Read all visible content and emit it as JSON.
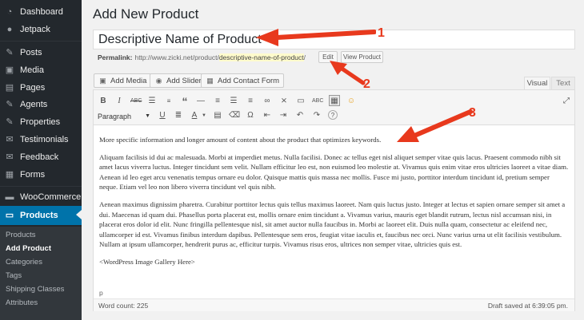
{
  "sidebar": {
    "items": [
      {
        "label": "Dashboard",
        "icon": "dashboard-icon",
        "glyph": "◔"
      },
      {
        "label": "Jetpack",
        "icon": "jetpack-icon",
        "glyph": "●"
      },
      {
        "label": "Posts",
        "icon": "pin-icon",
        "glyph": "✎"
      },
      {
        "label": "Media",
        "icon": "media-icon",
        "glyph": "▣"
      },
      {
        "label": "Pages",
        "icon": "pages-icon",
        "glyph": "▤"
      },
      {
        "label": "Agents",
        "icon": "pin-icon",
        "glyph": "✎"
      },
      {
        "label": "Properties",
        "icon": "pin-icon",
        "glyph": "✎"
      },
      {
        "label": "Testimonials",
        "icon": "comment-icon",
        "glyph": "✉"
      },
      {
        "label": "Feedback",
        "icon": "comment-icon",
        "glyph": "✉"
      },
      {
        "label": "Forms",
        "icon": "forms-icon",
        "glyph": "▦"
      },
      {
        "label": "WooCommerce",
        "icon": "woocommerce-icon",
        "glyph": "▬"
      },
      {
        "label": "Products",
        "icon": "products-icon",
        "glyph": "▭"
      }
    ],
    "submenu": [
      "Products",
      "Add Product",
      "Categories",
      "Tags",
      "Shipping Classes",
      "Attributes"
    ]
  },
  "header": {
    "title": "Add New Product"
  },
  "post": {
    "title_value": "Descriptive Name of Product",
    "permalink_label": "Permalink:",
    "permalink_base": "http://www.zicki.net/product/",
    "permalink_slug": "descriptive-name-of-product",
    "permalink_trail": "/",
    "edit_label": "Edit",
    "view_label": "View Product"
  },
  "media_buttons": {
    "add_media": "Add Media",
    "add_slider": "Add Slider",
    "add_contact_form": "Add Contact Form"
  },
  "tabs": {
    "visual": "Visual",
    "text": "Text"
  },
  "toolbar": {
    "format_select": "Paragraph"
  },
  "editor": {
    "intro": "More specific information and longer amount of content about the product that optimizes keywords.",
    "para1": "Aliquam facilisis id dui ac malesuada. Morbi at imperdiet metus. Nulla facilisi. Donec ac tellus eget nisl aliquet semper vitae quis lacus. Praesent commodo nibh sit amet lacus viverra luctus. Integer tincidunt sem velit. Nullam efficitur leo est, non euismod leo molestie at. Vivamus quis enim vitae eros ultricies laoreet a vitae diam. Aenean id leo eget arcu venenatis tempus ornare eu dolor. Quisque mattis quis massa nec mollis. Fusce mi justo, porttitor interdum tincidunt id, pretium semper neque. Etiam vel leo non libero viverra tincidunt vel quis nibh.",
    "para2": "Aenean maximus dignissim pharetra. Curabitur porttitor lectus quis tellus maximus laoreet. Nam quis luctus justo. Integer at lectus et sapien ornare semper sit amet a dui. Maecenas id quam dui. Phasellus porta placerat est, mollis ornare enim tincidunt a. Vivamus varius, mauris eget blandit rutrum, lectus nisl accumsan nisi, in placerat eros dolor id elit. Nunc fringilla pellentesque nisl, sit amet auctor nulla faucibus in. Morbi ac laoreet elit. Duis nulla quam, consectetur ac eleifend nec, ullamcorper id est. Vivamus finibus interdum dapibus. Pellentesque sem eros, feugiat vitae iaculis et, faucibus nec orci. Nunc varius urna ut elit facilisis vestibulum. Nullam at ipsum ullamcorper, hendrerit purus ac, efficitur turpis. Vivamus risus eros, ultrices non semper vitae, ultricies quis est.",
    "gallery": "<WordPress Image Gallery Here>",
    "path": "p",
    "word_count": "Word count: 225",
    "draft_saved": "Draft saved at 6:39:05 pm."
  },
  "annotations": {
    "one": "1",
    "two": "2",
    "three": "3",
    "arrow_color": "#e8391d"
  }
}
